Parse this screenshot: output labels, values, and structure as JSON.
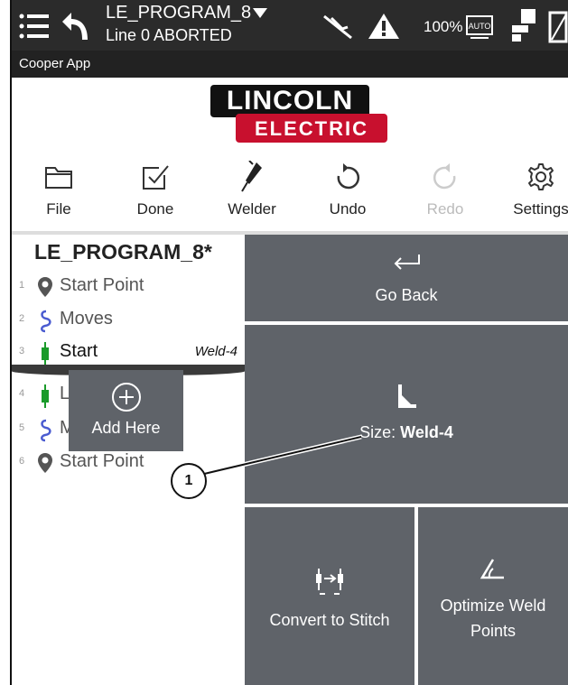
{
  "status_bar": {
    "program_title": "LE_PROGRAM_8",
    "subtitle": "Line 0 ABORTED",
    "battery": "100%",
    "icons": [
      "menu-icon",
      "back-arrow-icon",
      "torch-disabled-icon",
      "warning-icon",
      "auto-mode-icon",
      "robot-arm-icon",
      "tablet-icon"
    ]
  },
  "app_bar": {
    "title": "Cooper App"
  },
  "logo": {
    "line1": "LINCOLN",
    "line2": "ELECTRIC"
  },
  "toolbar": {
    "file": "File",
    "done": "Done",
    "welder": "Welder",
    "undo": "Undo",
    "redo": "Redo",
    "settings": "Settings"
  },
  "program": {
    "title": "LE_PROGRAM_8*",
    "rows": [
      {
        "num": "1",
        "label": "Start Point",
        "icon": "location-pin-icon"
      },
      {
        "num": "2",
        "label": "Moves",
        "icon": "moves-icon"
      },
      {
        "num": "3",
        "label": "Start",
        "icon": "weld-start-icon",
        "tag": "Weld-4"
      },
      {
        "num": "4",
        "label": "L",
        "icon": "weld-start-icon"
      },
      {
        "num": "5",
        "label": "M",
        "icon": "moves-icon"
      },
      {
        "num": "6",
        "label": "Start Point",
        "icon": "location-pin-icon"
      }
    ],
    "add_here": "Add Here"
  },
  "panel": {
    "go_back": "Go Back",
    "size_prefix": "Size: ",
    "size_value": "Weld-4",
    "convert": "Convert to Stitch",
    "optimize": "Optimize Weld Points"
  },
  "callout": {
    "number": "1"
  },
  "colors": {
    "tile": "#5f6369",
    "status_bar": "#2b2b2b",
    "brand_red": "#c8102e",
    "weld_green": "#1a9a2a",
    "moves_blue": "#4a5bd0"
  }
}
